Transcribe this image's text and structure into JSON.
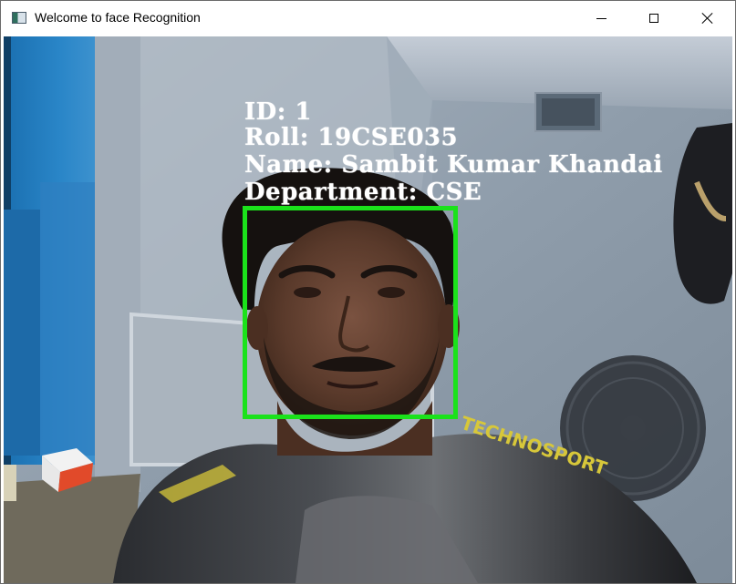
{
  "window": {
    "title": "Welcome to face Recognition",
    "controls": {
      "minimize": "minimize-icon",
      "maximize": "maximize-icon",
      "close": "close-icon"
    }
  },
  "recognition": {
    "id_label": "ID: 1",
    "roll_label": "Roll: 19CSE035",
    "name_label": "Name: Sambit Kumar Khandai",
    "department_label": "Department: CSE",
    "box_color": "#1be21b",
    "text_color": "#ffffff"
  },
  "scene": {
    "shirt_text": "TECHNOSPORT"
  }
}
